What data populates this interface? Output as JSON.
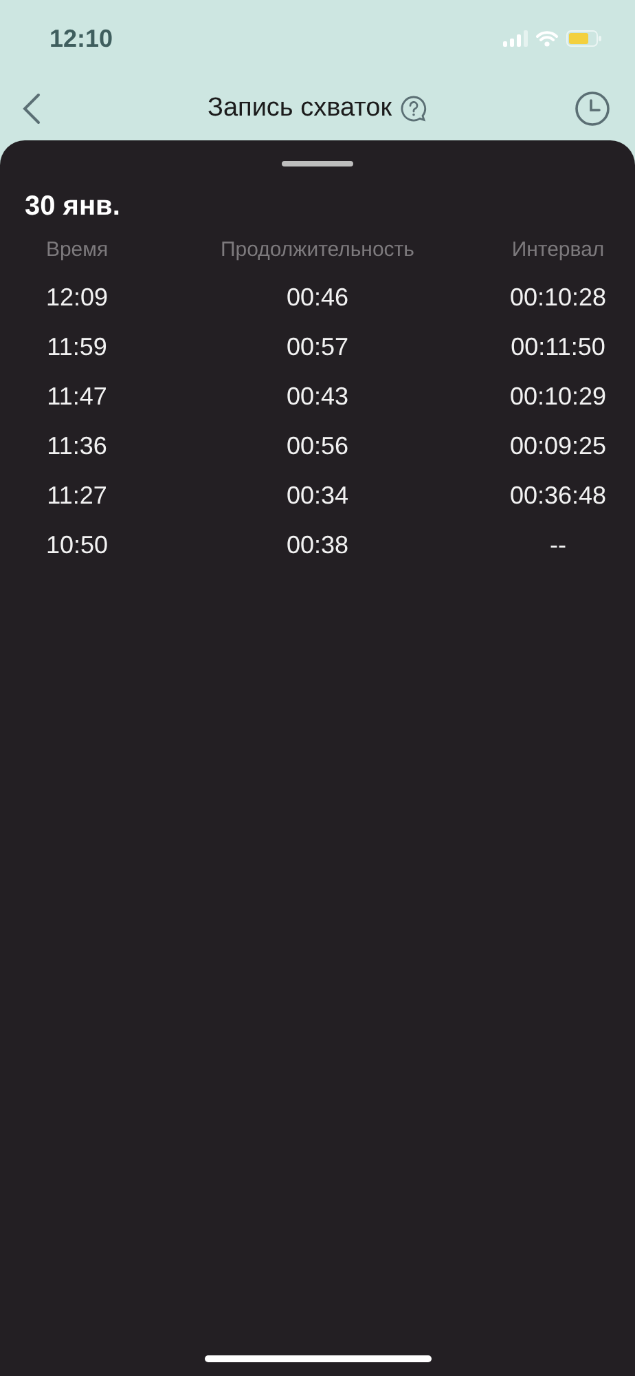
{
  "status_bar": {
    "time": "12:10"
  },
  "nav": {
    "title": "Запись схваток"
  },
  "date": "30 янв.",
  "table": {
    "columns": [
      "Время",
      "Продолжительность",
      "Интервал"
    ],
    "rows": [
      [
        "12:09",
        "00:46",
        "00:10:28"
      ],
      [
        "11:59",
        "00:57",
        "00:11:50"
      ],
      [
        "11:47",
        "00:43",
        "00:10:29"
      ],
      [
        "11:36",
        "00:56",
        "00:09:25"
      ],
      [
        "11:27",
        "00:34",
        "00:36:48"
      ],
      [
        "10:50",
        "00:38",
        "--"
      ]
    ]
  }
}
